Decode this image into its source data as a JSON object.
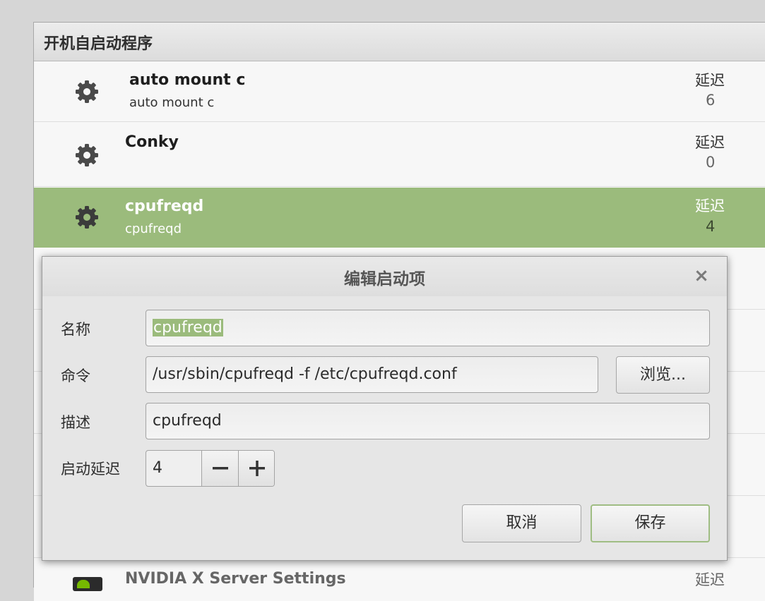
{
  "window": {
    "header": "开机自启动程序",
    "delay_label": "延迟",
    "rows": [
      {
        "name": "auto mount c",
        "subtitle": "auto mount c",
        "delay": "6"
      },
      {
        "name": "Conky",
        "subtitle": "",
        "delay": "0"
      },
      {
        "name": "cpufreqd",
        "subtitle": "cpufreqd",
        "delay": "4"
      },
      {
        "name": "NVIDIA X Server Settings",
        "subtitle": "",
        "delay": ""
      }
    ]
  },
  "dialog": {
    "title": "编辑启动项",
    "close_glyph": "×",
    "name_label": "名称",
    "name_value": "cpufreqd",
    "command_label": "命令",
    "command_value": "/usr/sbin/cpufreqd -f /etc/cpufreqd.conf",
    "browse_label": "浏览...",
    "description_label": "描述",
    "description_value": "cpufreqd",
    "delay_label": "启动延迟",
    "delay_value": "4",
    "cancel_label": "取消",
    "save_label": "保存"
  },
  "colors": {
    "selection": "#9bbb7c",
    "default_button_border": "#9fbd83"
  }
}
